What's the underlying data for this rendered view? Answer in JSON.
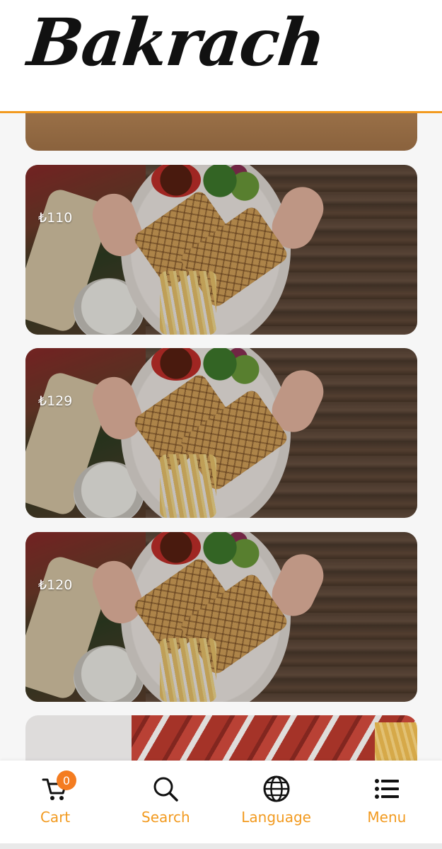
{
  "brand": {
    "logo_text": "Bakrach",
    "accent_color": "#f29a1f"
  },
  "products": [
    {
      "price": ""
    },
    {
      "price": "₺110"
    },
    {
      "price": "₺129"
    },
    {
      "price": "₺120"
    },
    {
      "price": ""
    }
  ],
  "bottom_nav": {
    "cart": {
      "label": "Cart",
      "badge": "0",
      "icon": "cart-icon"
    },
    "search": {
      "label": "Search",
      "icon": "search-icon"
    },
    "language": {
      "label": "Language",
      "icon": "globe-icon"
    },
    "menu": {
      "label": "Menu",
      "icon": "list-icon"
    }
  }
}
